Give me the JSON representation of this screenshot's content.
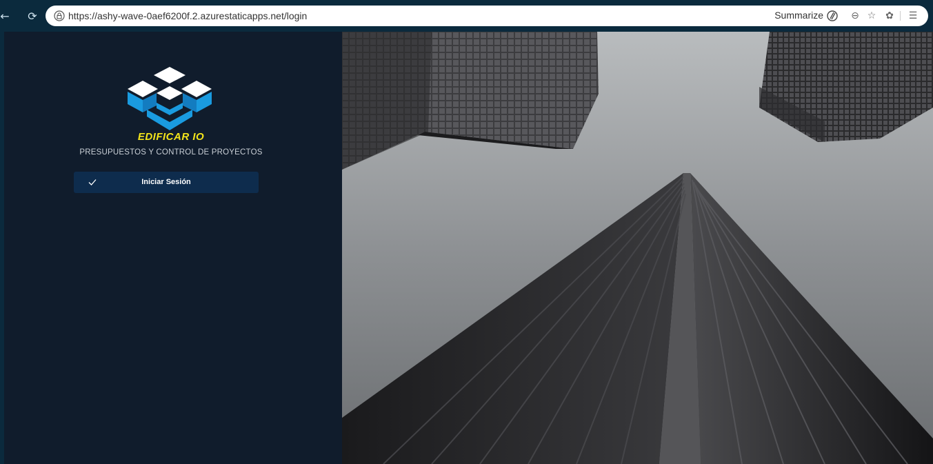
{
  "browser": {
    "url": "https://ashy-wave-0aef6200f.2.azurestaticapps.net/login",
    "summarize_label": "Summarize",
    "back_icon": "back-arrow-icon",
    "refresh_icon": "refresh-icon"
  },
  "app": {
    "brand": "EDIFICAR IO",
    "tagline": "PRESUPUESTOS Y CONTROL DE PROYECTOS",
    "login_button": "Iniciar Sesión"
  },
  "colors": {
    "panel": "#101c2c",
    "button": "#0e2c4d",
    "brand": "#f4e51a",
    "logo_blue": "#1a9be0"
  }
}
